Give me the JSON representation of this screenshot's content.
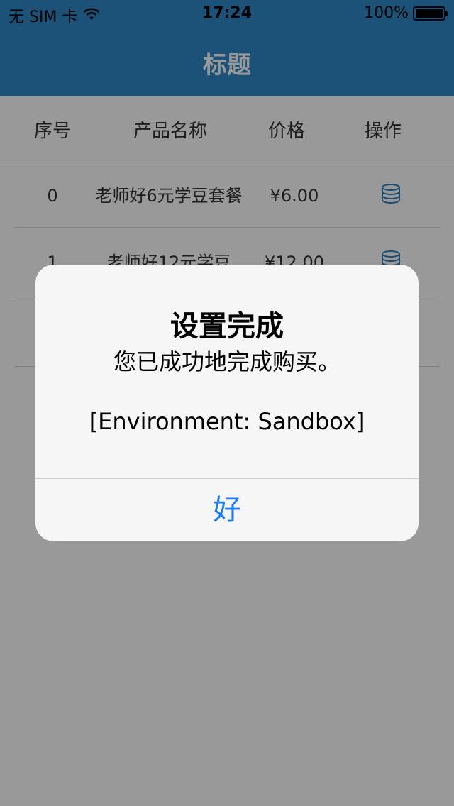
{
  "status_bar": {
    "carrier": "无 SIM 卡",
    "time": "17:24",
    "battery_text": "100%",
    "battery_level": 1.0
  },
  "nav": {
    "title": "标题"
  },
  "table": {
    "headers": [
      "序号",
      "产品名称",
      "价格",
      "操作"
    ],
    "rows": [
      {
        "index": "0",
        "name": "老师好6元学豆套餐",
        "price": "¥6.00",
        "action_icon": "database-icon"
      },
      {
        "index": "1",
        "name": "老师好12元学豆",
        "price": "¥12.00",
        "action_icon": "database-icon"
      },
      {
        "index": "",
        "name": "",
        "price": "",
        "action_icon": "database-icon"
      }
    ]
  },
  "alert": {
    "title": "设置完成",
    "message": "您已成功地完成购买。",
    "environment": "[Environment: Sandbox]",
    "ok_label": "好"
  },
  "colors": {
    "nav_bar": "#2f89c8",
    "ok_button": "#1a7ef5",
    "icon": "#2f7fbf"
  }
}
